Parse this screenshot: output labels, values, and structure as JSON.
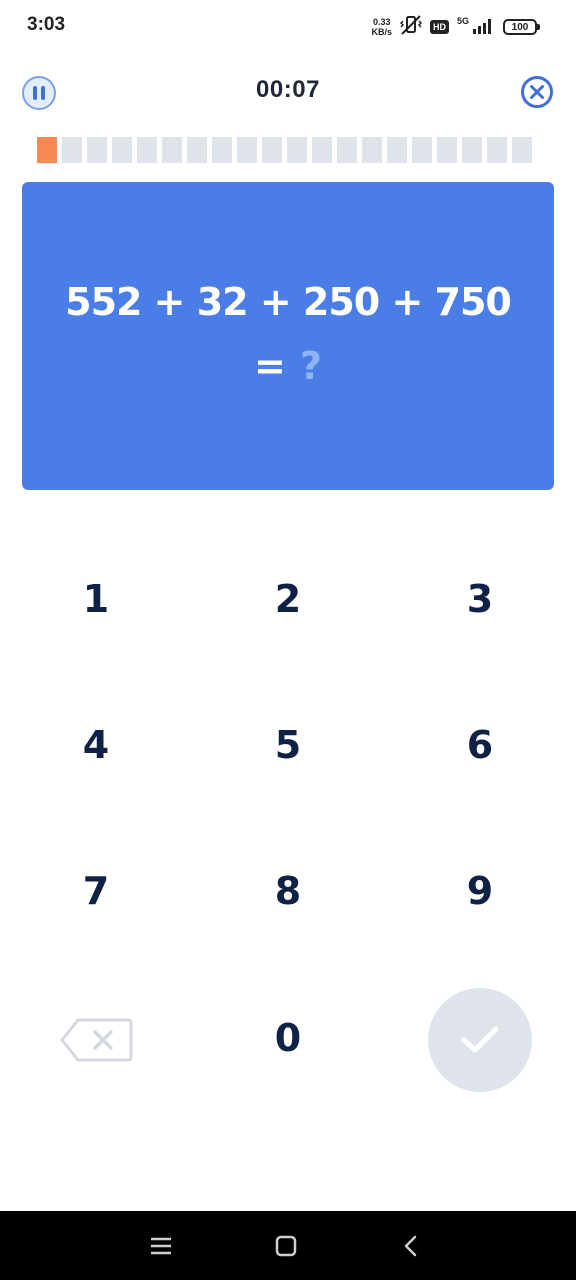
{
  "status_bar": {
    "time": "3:03",
    "net_speed_value": "0.33",
    "net_speed_unit": "KB/s",
    "hd_badge": "HD",
    "network_type": "5G",
    "battery": "100",
    "icons": [
      "vibrate-off-icon",
      "signal-icon",
      "battery-icon"
    ]
  },
  "header": {
    "timer": "00:07",
    "pause_icon": "pause-icon",
    "close_icon": "close-circle-icon"
  },
  "progress": {
    "total_segments": 20,
    "completed_segments": 1,
    "done_color": "#f98a54",
    "pending_color": "#dfe3ea"
  },
  "question": {
    "expression": "552 + 32 + 250 + 750",
    "equals": "=",
    "answer_placeholder": "?",
    "card_color": "#4a7ee6"
  },
  "keypad": {
    "keys": [
      "1",
      "2",
      "3",
      "4",
      "5",
      "6",
      "7",
      "8",
      "9",
      "0"
    ],
    "backspace_icon": "backspace-icon",
    "submit_icon": "checkmark-icon"
  },
  "nav_bar": {
    "icons": [
      "menu-icon",
      "home-icon",
      "back-icon"
    ]
  }
}
